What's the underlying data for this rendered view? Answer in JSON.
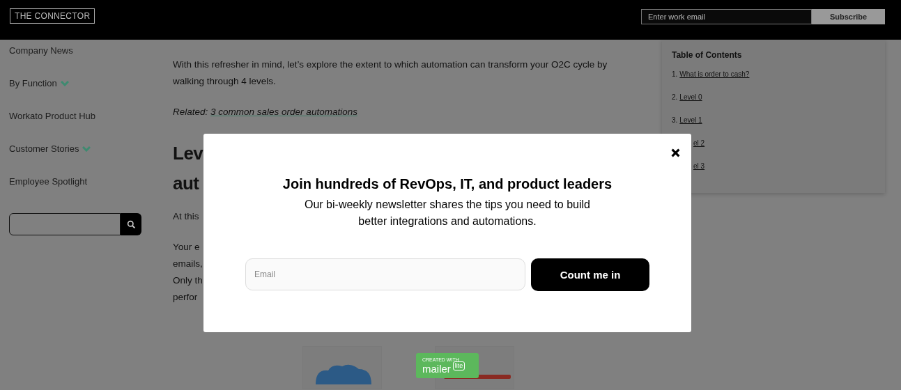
{
  "header": {
    "logo": "THE CONNECTOR",
    "subscribe": {
      "placeholder": "Enter work email",
      "button": "Subscribe"
    }
  },
  "sidebar": {
    "items": [
      {
        "label": "Company News",
        "expandable": false
      },
      {
        "label": "By Function",
        "expandable": true
      },
      {
        "label": "Workato Product Hub",
        "expandable": false
      },
      {
        "label": "Customer Stories",
        "expandable": true
      },
      {
        "label": "Employee Spotlight",
        "expandable": false
      }
    ]
  },
  "article": {
    "paragraph": "With this refresher in mind, let’s explore the extent to which automation can transform your O2C cycle by walking through 4 levels.",
    "related": {
      "prefix": "Related:",
      "link": "3 common sales order automations"
    },
    "heading_lines": [
      "Lev",
      "aut"
    ],
    "intro": "At this",
    "body_lines": [
      "Your e",
      "emails,",
      "Only th",
      "perfor"
    ]
  },
  "toc": {
    "title": "Table of Contents",
    "items": [
      {
        "number": "1.",
        "label": "What is order to cash?"
      },
      {
        "number": "2.",
        "label": "Level 0"
      },
      {
        "number": "3.",
        "label": "Level 1"
      },
      {
        "label": "el 2"
      },
      {
        "label": "el 3"
      }
    ]
  },
  "modal": {
    "title": "Join hundreds of RevOps, IT, and product leaders",
    "text": "Our bi-weekly newsletter shares the tips you need to build better integrations and automations.",
    "email_placeholder": "Email",
    "button": "Count me in"
  },
  "badge": {
    "caption": "CREATED WITH",
    "brand": "mailer",
    "tag": "lite"
  }
}
